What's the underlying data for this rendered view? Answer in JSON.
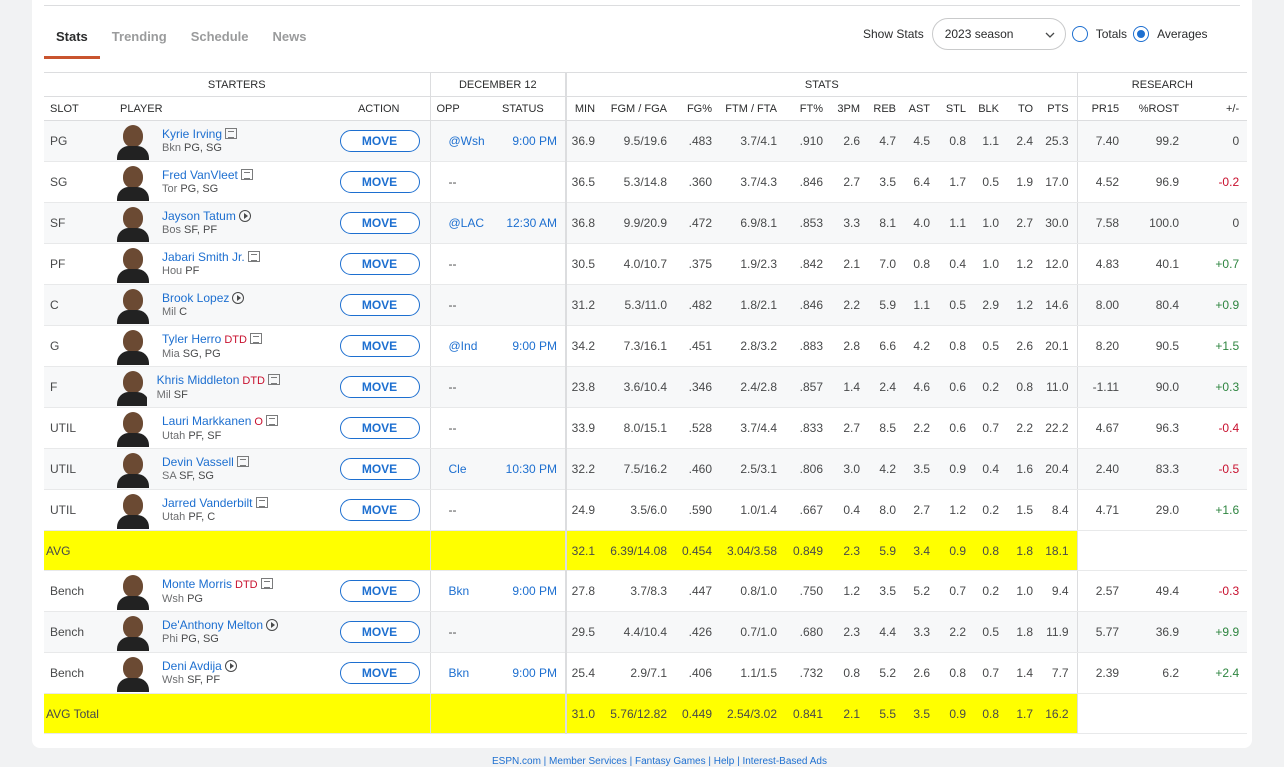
{
  "tabs": [
    "Stats",
    "Trending",
    "Schedule",
    "News"
  ],
  "show_stats": {
    "label": "Show Stats",
    "season": "2023 season",
    "totals": "Totals",
    "averages": "Averages",
    "selected": "Averages"
  },
  "groups": {
    "starters": "STARTERS",
    "date": "DECEMBER 12",
    "stats": "STATS",
    "research": "RESEARCH"
  },
  "columns": [
    "SLOT",
    "PLAYER",
    "ACTION",
    "OPP",
    "STATUS",
    "MIN",
    "FGM / FGA",
    "FG%",
    "FTM / FTA",
    "FT%",
    "3PM",
    "REB",
    "AST",
    "STL",
    "BLK",
    "TO",
    "PTS",
    "PR15",
    "%ROST",
    "+/-"
  ],
  "move_label": "MOVE",
  "starters": [
    {
      "slot": "PG",
      "name": "Kyrie Irving",
      "team": "Bkn",
      "pos": "PG, SG",
      "inj": "",
      "icon": "news",
      "opp": "@Wsh",
      "status": "9:00 PM",
      "stats": [
        "36.9",
        "9.5/19.6",
        ".483",
        "3.7/4.1",
        ".910",
        "2.6",
        "4.7",
        "4.5",
        "0.8",
        "1.1",
        "2.4",
        "25.3"
      ],
      "pr15": "7.40",
      "rost": "99.2",
      "pm": "0"
    },
    {
      "slot": "SG",
      "name": "Fred VanVleet",
      "team": "Tor",
      "pos": "PG, SG",
      "inj": "",
      "icon": "news",
      "opp": "--",
      "status": "",
      "stats": [
        "36.5",
        "5.3/14.8",
        ".360",
        "3.7/4.3",
        ".846",
        "2.7",
        "3.5",
        "6.4",
        "1.7",
        "0.5",
        "1.9",
        "17.0"
      ],
      "pr15": "4.52",
      "rost": "96.9",
      "pm": "-0.2"
    },
    {
      "slot": "SF",
      "name": "Jayson Tatum",
      "team": "Bos",
      "pos": "SF, PF",
      "inj": "",
      "icon": "play",
      "opp": "@LAC",
      "status": "12:30 AM",
      "stats": [
        "36.8",
        "9.9/20.9",
        ".472",
        "6.9/8.1",
        ".853",
        "3.3",
        "8.1",
        "4.0",
        "1.1",
        "1.0",
        "2.7",
        "30.0"
      ],
      "pr15": "7.58",
      "rost": "100.0",
      "pm": "0"
    },
    {
      "slot": "PF",
      "name": "Jabari Smith Jr.",
      "team": "Hou",
      "pos": "PF",
      "inj": "",
      "icon": "news",
      "opp": "--",
      "status": "",
      "stats": [
        "30.5",
        "4.0/10.7",
        ".375",
        "1.9/2.3",
        ".842",
        "2.1",
        "7.0",
        "0.8",
        "0.4",
        "1.0",
        "1.2",
        "12.0"
      ],
      "pr15": "4.83",
      "rost": "40.1",
      "pm": "+0.7"
    },
    {
      "slot": "C",
      "name": "Brook Lopez",
      "team": "Mil",
      "pos": "C",
      "inj": "",
      "icon": "play",
      "opp": "--",
      "status": "",
      "stats": [
        "31.2",
        "5.3/11.0",
        ".482",
        "1.8/2.1",
        ".846",
        "2.2",
        "5.9",
        "1.1",
        "0.5",
        "2.9",
        "1.2",
        "14.6"
      ],
      "pr15": "8.00",
      "rost": "80.4",
      "pm": "+0.9"
    },
    {
      "slot": "G",
      "name": "Tyler Herro",
      "team": "Mia",
      "pos": "SG, PG",
      "inj": "DTD",
      "icon": "news",
      "opp": "@Ind",
      "status": "9:00 PM",
      "stats": [
        "34.2",
        "7.3/16.1",
        ".451",
        "2.8/3.2",
        ".883",
        "2.8",
        "6.6",
        "4.2",
        "0.8",
        "0.5",
        "2.6",
        "20.1"
      ],
      "pr15": "8.20",
      "rost": "90.5",
      "pm": "+1.5"
    },
    {
      "slot": "F",
      "name": "Khris Middleton",
      "team": "Mil",
      "pos": "SF",
      "inj": "DTD",
      "icon": "news",
      "opp": "--",
      "status": "",
      "stats": [
        "23.8",
        "3.6/10.4",
        ".346",
        "2.4/2.8",
        ".857",
        "1.4",
        "2.4",
        "4.6",
        "0.6",
        "0.2",
        "0.8",
        "11.0"
      ],
      "pr15": "-1.11",
      "rost": "90.0",
      "pm": "+0.3"
    },
    {
      "slot": "UTIL",
      "name": "Lauri Markkanen",
      "team": "Utah",
      "pos": "PF, SF",
      "inj": "O",
      "icon": "news",
      "opp": "--",
      "status": "",
      "stats": [
        "33.9",
        "8.0/15.1",
        ".528",
        "3.7/4.4",
        ".833",
        "2.7",
        "8.5",
        "2.2",
        "0.6",
        "0.7",
        "2.2",
        "22.2"
      ],
      "pr15": "4.67",
      "rost": "96.3",
      "pm": "-0.4"
    },
    {
      "slot": "UTIL",
      "name": "Devin Vassell",
      "team": "SA",
      "pos": "SF, SG",
      "inj": "",
      "icon": "news",
      "opp": "Cle",
      "status": "10:30 PM",
      "stats": [
        "32.2",
        "7.5/16.2",
        ".460",
        "2.5/3.1",
        ".806",
        "3.0",
        "4.2",
        "3.5",
        "0.9",
        "0.4",
        "1.6",
        "20.4"
      ],
      "pr15": "2.40",
      "rost": "83.3",
      "pm": "-0.5"
    },
    {
      "slot": "UTIL",
      "name": "Jarred Vanderbilt",
      "team": "Utah",
      "pos": "PF, C",
      "inj": "",
      "icon": "news",
      "opp": "--",
      "status": "",
      "stats": [
        "24.9",
        "3.5/6.0",
        ".590",
        "1.0/1.4",
        ".667",
        "0.4",
        "8.0",
        "2.7",
        "1.2",
        "0.2",
        "1.5",
        "8.4"
      ],
      "pr15": "4.71",
      "rost": "29.0",
      "pm": "+1.6"
    }
  ],
  "avg": {
    "label": "AVG",
    "stats": [
      "32.1",
      "6.39/14.08",
      "0.454",
      "3.04/3.58",
      "0.849",
      "2.3",
      "5.9",
      "3.4",
      "0.9",
      "0.8",
      "1.8",
      "18.1"
    ]
  },
  "bench": [
    {
      "slot": "Bench",
      "name": "Monte Morris",
      "team": "Wsh",
      "pos": "PG",
      "inj": "DTD",
      "icon": "news",
      "opp": "Bkn",
      "status": "9:00 PM",
      "stats": [
        "27.8",
        "3.7/8.3",
        ".447",
        "0.8/1.0",
        ".750",
        "1.2",
        "3.5",
        "5.2",
        "0.7",
        "0.2",
        "1.0",
        "9.4"
      ],
      "pr15": "2.57",
      "rost": "49.4",
      "pm": "-0.3"
    },
    {
      "slot": "Bench",
      "name": "De'Anthony Melton",
      "team": "Phi",
      "pos": "PG, SG",
      "inj": "",
      "icon": "play",
      "opp": "--",
      "status": "",
      "stats": [
        "29.5",
        "4.4/10.4",
        ".426",
        "0.7/1.0",
        ".680",
        "2.3",
        "4.4",
        "3.3",
        "2.2",
        "0.5",
        "1.8",
        "11.9"
      ],
      "pr15": "5.77",
      "rost": "36.9",
      "pm": "+9.9"
    },
    {
      "slot": "Bench",
      "name": "Deni Avdija",
      "team": "Wsh",
      "pos": "SF, PF",
      "inj": "",
      "icon": "play",
      "opp": "Bkn",
      "status": "9:00 PM",
      "stats": [
        "25.4",
        "2.9/7.1",
        ".406",
        "1.1/1.5",
        ".732",
        "0.8",
        "5.2",
        "2.6",
        "0.8",
        "0.7",
        "1.4",
        "7.7"
      ],
      "pr15": "2.39",
      "rost": "6.2",
      "pm": "+2.4"
    }
  ],
  "avg_total": {
    "label": "AVG Total",
    "stats": [
      "31.0",
      "5.76/12.82",
      "0.449",
      "2.54/3.02",
      "0.841",
      "2.1",
      "5.5",
      "3.5",
      "0.9",
      "0.8",
      "1.7",
      "16.2"
    ]
  },
  "footer": "ESPN.com | Member Services | Fantasy Games | Help | Interest-Based Ads",
  "colors": {
    "accent": "#1d6fd0",
    "tab_underline": "#c9542f",
    "highlight": "#ffff00",
    "positive": "#2e8540",
    "negative": "#c8102e"
  }
}
